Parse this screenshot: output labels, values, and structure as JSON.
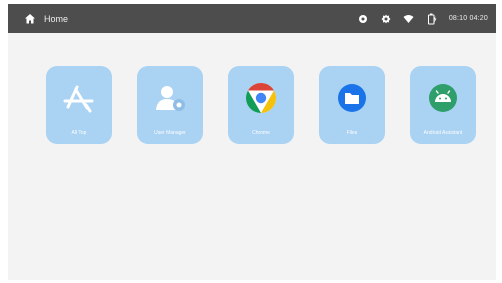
{
  "statusbar": {
    "title": "Home",
    "time": "08:10 04:20",
    "icons": [
      "settings-gear-icon",
      "brightness-icon",
      "wifi-icon",
      "battery-charging-icon"
    ]
  },
  "apps": [
    {
      "label": "All Top",
      "icon": "app-store-icon"
    },
    {
      "label": "User Manager",
      "icon": "user-manager-icon"
    },
    {
      "label": "Chrome",
      "icon": "chrome-icon"
    },
    {
      "label": "Files",
      "icon": "folder-icon"
    },
    {
      "label": "Android Assistant",
      "icon": "android-icon"
    }
  ],
  "colors": {
    "statusbar_bg": "#4d4d4d",
    "screen_bg": "#f3f3f3",
    "tile_bg": "#a9d2f3",
    "accent_blue": "#1a73e8",
    "android_green": "#2e9e6a"
  }
}
